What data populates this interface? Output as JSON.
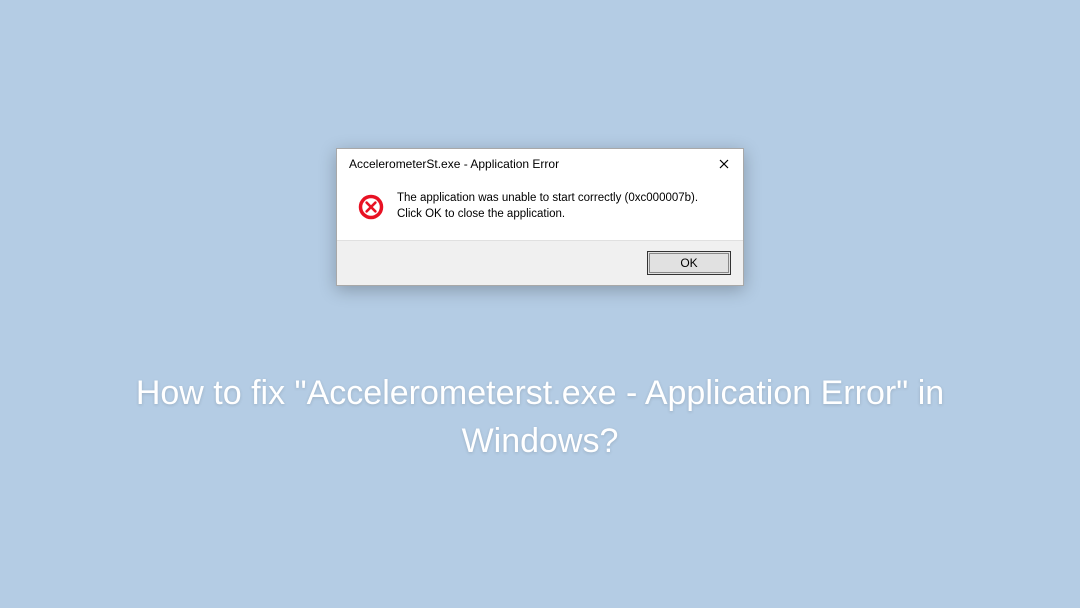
{
  "dialog": {
    "title": "AccelerometerSt.exe - Application Error",
    "message": "The application was unable to start correctly (0xc000007b). Click OK to close the application.",
    "ok_label": "OK"
  },
  "headline": "How to fix \"Accelerometerst.exe - Application Error\" in Windows?"
}
